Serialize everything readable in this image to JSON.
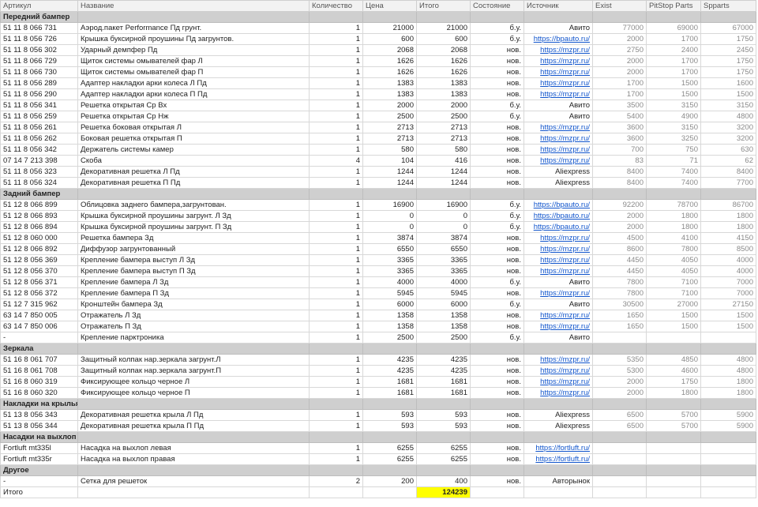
{
  "columns": [
    "Артикул",
    "Название",
    "Количество",
    "Цена",
    "Итого",
    "Состояние",
    "Источник",
    "Exist",
    "PitStop Parts",
    "Spparts"
  ],
  "rows": [
    {
      "section": "Передний бампер"
    },
    {
      "cells": [
        "51 11 8 066 731",
        "Аэрод.пакет Performance Пд грунт.",
        "1",
        "21000",
        "21000",
        "б.у.",
        "Авито",
        "77000",
        "69000",
        "67000"
      ]
    },
    {
      "cells": [
        "51 11 8 056 726",
        "Крышка буксирной проушины Пд загрунтов.",
        "1",
        "600",
        "600",
        "б.у.",
        "https://bpauto.ru/",
        "2000",
        "1700",
        "1750"
      ]
    },
    {
      "cells": [
        "51 11 8 056 302",
        "Ударный демпфер Пд",
        "1",
        "2068",
        "2068",
        "нов.",
        "https://mzpr.ru/",
        "2750",
        "2400",
        "2450"
      ]
    },
    {
      "cells": [
        "51 11 8 066 729",
        "Щиток системы омывателей фар Л",
        "1",
        "1626",
        "1626",
        "нов.",
        "https://mzpr.ru/",
        "2000",
        "1700",
        "1750"
      ]
    },
    {
      "cells": [
        "51 11 8 066 730",
        "Щиток системы омывателей фар П",
        "1",
        "1626",
        "1626",
        "нов.",
        "https://mzpr.ru/",
        "2000",
        "1700",
        "1750"
      ]
    },
    {
      "cells": [
        "51 11 8 056 289",
        "Адаптер накладки арки колеса Л Пд",
        "1",
        "1383",
        "1383",
        "нов.",
        "https://mzpr.ru/",
        "1700",
        "1500",
        "1600"
      ]
    },
    {
      "cells": [
        "51 11 8 056 290",
        "Адаптер накладки арки колеса П Пд",
        "1",
        "1383",
        "1383",
        "нов.",
        "https://mzpr.ru/",
        "1700",
        "1500",
        "1500"
      ]
    },
    {
      "cells": [
        "51 11 8 056 341",
        "Решетка открытая Ср Вх",
        "1",
        "2000",
        "2000",
        "б.у.",
        "Авито",
        "3500",
        "3150",
        "3150"
      ]
    },
    {
      "cells": [
        "51 11 8 056 259",
        "Решетка открытая Ср Нж",
        "1",
        "2500",
        "2500",
        "б.у.",
        "Авито",
        "5400",
        "4900",
        "4800"
      ]
    },
    {
      "cells": [
        "51 11 8 056 261",
        "Решетка боковая открытая Л",
        "1",
        "2713",
        "2713",
        "нов.",
        "https://mzpr.ru/",
        "3600",
        "3150",
        "3200"
      ]
    },
    {
      "cells": [
        "51 11 8 056 262",
        "Боковая решетка открытая П",
        "1",
        "2713",
        "2713",
        "нов.",
        "https://mzpr.ru/",
        "3600",
        "3250",
        "3200"
      ]
    },
    {
      "cells": [
        "51 11 8 056 342",
        "Держатель системы камер",
        "1",
        "580",
        "580",
        "нов.",
        "https://mzpr.ru/",
        "700",
        "750",
        "630"
      ]
    },
    {
      "cells": [
        "07 14 7 213 398",
        "Скоба",
        "4",
        "104",
        "416",
        "нов.",
        "https://mzpr.ru/",
        "83",
        "71",
        "62"
      ]
    },
    {
      "cells": [
        "51 11 8 056 323",
        "Декоративная решетка Л Пд",
        "1",
        "1244",
        "1244",
        "нов.",
        "Aliexpress",
        "8400",
        "7400",
        "8400"
      ]
    },
    {
      "cells": [
        "51 11 8 056 324",
        "Декоративная решетка П Пд",
        "1",
        "1244",
        "1244",
        "нов.",
        "Aliexpress",
        "8400",
        "7400",
        "7700"
      ]
    },
    {
      "section": "Задний бампер"
    },
    {
      "cells": [
        "51 12 8 066 899",
        "Облицовка заднего бампера,загрунтован.",
        "1",
        "16900",
        "16900",
        "б.у.",
        "https://bpauto.ru/",
        "92200",
        "78700",
        "86700"
      ]
    },
    {
      "cells": [
        "51 12 8 066 893",
        "Крышка буксирной проушины загрунт. Л Зд",
        "1",
        "0",
        "0",
        "б.у.",
        "https://bpauto.ru/",
        "2000",
        "1800",
        "1800"
      ]
    },
    {
      "cells": [
        "51 12 8 066 894",
        "Крышка буксирной проушины загрунт. П Зд",
        "1",
        "0",
        "0",
        "б.у.",
        "https://bpauto.ru/",
        "2000",
        "1800",
        "1800"
      ]
    },
    {
      "cells": [
        "51 12 8 060 000",
        "Решетка бампера Зд",
        "1",
        "3874",
        "3874",
        "нов.",
        "https://mzpr.ru/",
        "4500",
        "4100",
        "4150"
      ]
    },
    {
      "cells": [
        "51 12 8 066 892",
        "Диффузор загрунтованный",
        "1",
        "6550",
        "6550",
        "нов.",
        "https://mzpr.ru/",
        "8600",
        "7800",
        "8500"
      ]
    },
    {
      "cells": [
        "51 12 8 056 369",
        "Крепление бампера выступ Л Зд",
        "1",
        "3365",
        "3365",
        "нов.",
        "https://mzpr.ru/",
        "4450",
        "4050",
        "4000"
      ]
    },
    {
      "cells": [
        "51 12 8 056 370",
        "Крепление бампера выступ П Зд",
        "1",
        "3365",
        "3365",
        "нов.",
        "https://mzpr.ru/",
        "4450",
        "4050",
        "4000"
      ]
    },
    {
      "cells": [
        "51 12 8 056 371",
        "Крепление бампера Л Зд",
        "1",
        "4000",
        "4000",
        "б.у.",
        "Авито",
        "7800",
        "7100",
        "7000"
      ]
    },
    {
      "cells": [
        "51 12 8 056 372",
        "Крепление бампера П Зд",
        "1",
        "5945",
        "5945",
        "нов.",
        "https://mzpr.ru/",
        "7800",
        "7100",
        "7000"
      ]
    },
    {
      "cells": [
        "51 12 7 315 962",
        "Кронштейн бампера Зд",
        "1",
        "6000",
        "6000",
        "б.у.",
        "Авито",
        "30500",
        "27000",
        "27150"
      ]
    },
    {
      "cells": [
        "63 14 7 850 005",
        "Отражатель Л Зд",
        "1",
        "1358",
        "1358",
        "нов.",
        "https://mzpr.ru/",
        "1650",
        "1500",
        "1500"
      ]
    },
    {
      "cells": [
        "63 14 7 850 006",
        "Отражатель П Зд",
        "1",
        "1358",
        "1358",
        "нов.",
        "https://mzpr.ru/",
        "1650",
        "1500",
        "1500"
      ]
    },
    {
      "cells": [
        "-",
        "Крепление парктроника",
        "1",
        "2500",
        "2500",
        "б.у.",
        "Авито",
        "",
        "",
        ""
      ]
    },
    {
      "section": "Зеркала"
    },
    {
      "cells": [
        "51 16 8 061 707",
        "Защитный колпак нар.зеркала загрунт.Л",
        "1",
        "4235",
        "4235",
        "нов.",
        "https://mzpr.ru/",
        "5350",
        "4850",
        "4800"
      ]
    },
    {
      "cells": [
        "51 16 8 061 708",
        "Защитный колпак нар.зеркала загрунт.П",
        "1",
        "4235",
        "4235",
        "нов.",
        "https://mzpr.ru/",
        "5300",
        "4600",
        "4800"
      ]
    },
    {
      "cells": [
        "51 16 8 060 319",
        "Фиксирующее кольцо черное Л",
        "1",
        "1681",
        "1681",
        "нов.",
        "https://mzpr.ru/",
        "2000",
        "1750",
        "1800"
      ]
    },
    {
      "cells": [
        "51 16 8 060 320",
        "Фиксирующее кольцо черное П",
        "1",
        "1681",
        "1681",
        "нов.",
        "https://mzpr.ru/",
        "2000",
        "1800",
        "1800"
      ]
    },
    {
      "section": "Накладки на крылья"
    },
    {
      "cells": [
        "51 13 8 056 343",
        "Декоративная решетка крыла Л Пд",
        "1",
        "593",
        "593",
        "нов.",
        "Aliexpress",
        "6500",
        "5700",
        "5900"
      ]
    },
    {
      "cells": [
        "51 13 8 056 344",
        "Декоративная решетка крыла П Пд",
        "1",
        "593",
        "593",
        "нов.",
        "Aliexpress",
        "6500",
        "5700",
        "5900"
      ]
    },
    {
      "section": "Насадки на выхлоп"
    },
    {
      "cells": [
        "Fortluft mt335l",
        "Насадка на выхлоп левая",
        "1",
        "6255",
        "6255",
        "нов.",
        "https://fortluft.ru/",
        "",
        "",
        ""
      ]
    },
    {
      "cells": [
        "Fortluft mt335r",
        "Насадка на выхлоп правая",
        "1",
        "6255",
        "6255",
        "нов.",
        "https://fortluft.ru/",
        "",
        "",
        ""
      ]
    },
    {
      "section": "Другое"
    },
    {
      "cells": [
        "-",
        "Сетка для решеток",
        "2",
        "200",
        "400",
        "нов.",
        "Авторынок",
        "",
        "",
        ""
      ]
    }
  ],
  "total": {
    "label": "Итого",
    "value": "124239"
  },
  "colors": {
    "header_bg": "#f2f2f2",
    "section_bg": "#cfcfcf",
    "link": "#1155cc",
    "total_highlight": "#ffff00"
  }
}
